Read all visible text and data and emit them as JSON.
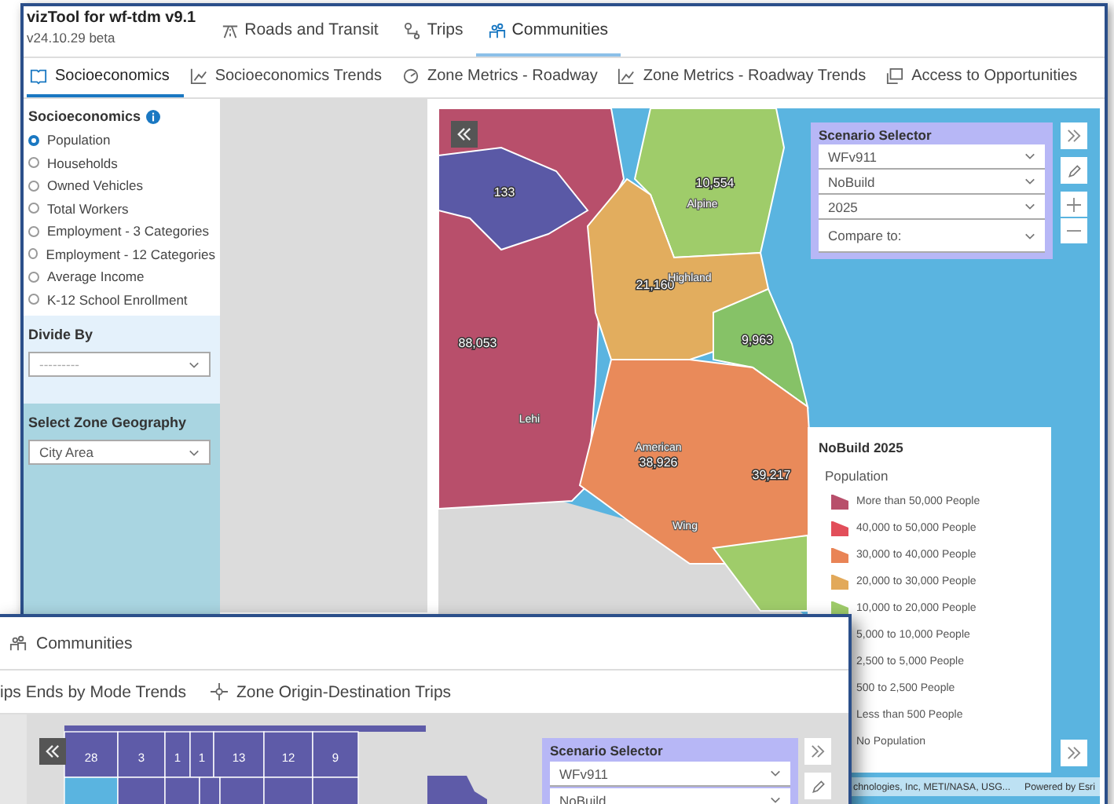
{
  "main_window": {
    "app_title": "vizTool for wf-tdm v9.1",
    "version": "v24.10.29 beta",
    "tabs": [
      {
        "label": "Roads and Transit",
        "selected": false
      },
      {
        "label": "Trips",
        "selected": false
      },
      {
        "label": "Communities",
        "selected": true
      }
    ],
    "subtabs": [
      {
        "label": "Socioeconomics",
        "selected": true
      },
      {
        "label": "Socioeconomics Trends",
        "selected": false
      },
      {
        "label": "Zone Metrics - Roadway",
        "selected": false
      },
      {
        "label": "Zone Metrics - Roadway Trends",
        "selected": false
      },
      {
        "label": "Access to Opportunities",
        "selected": false
      }
    ],
    "sidebar": {
      "heading": "Socioeconomics",
      "radios": [
        {
          "label": "Population",
          "selected": true
        },
        {
          "label": "Households",
          "selected": false
        },
        {
          "label": "Owned Vehicles",
          "selected": false
        },
        {
          "label": "Total Workers",
          "selected": false
        },
        {
          "label": "Employment - 3 Categories",
          "selected": false
        },
        {
          "label": "Employment - 12 Categories",
          "selected": false
        },
        {
          "label": "Average Income",
          "selected": false
        },
        {
          "label": "K-12 School Enrollment",
          "selected": false
        }
      ],
      "divide_by": {
        "label": "Divide By",
        "placeholder": "---------"
      },
      "zone_geography": {
        "label": "Select Zone Geography",
        "value": "City Area"
      }
    },
    "map": {
      "labels": [
        {
          "kind": "value",
          "text": "133"
        },
        {
          "kind": "value",
          "text": "10,554"
        },
        {
          "kind": "place",
          "text": "Alpine"
        },
        {
          "kind": "value",
          "text": "21,160"
        },
        {
          "kind": "place",
          "text": "Highland"
        },
        {
          "kind": "value",
          "text": "9,963"
        },
        {
          "kind": "value",
          "text": "88,053"
        },
        {
          "kind": "place",
          "text": "Lehi"
        },
        {
          "kind": "place",
          "text": "American"
        },
        {
          "kind": "value",
          "text": "38,926"
        },
        {
          "kind": "value",
          "text": "39,217"
        },
        {
          "kind": "place",
          "text": "Wing"
        }
      ],
      "scenario_selector": {
        "title": "Scenario Selector",
        "selects": [
          "WFv911",
          "NoBuild",
          "2025"
        ],
        "compare_placeholder": "Compare to:"
      },
      "legend": {
        "title": "NoBuild 2025",
        "subtitle": "Population",
        "items": [
          {
            "label": "More than 50,000 People",
            "color": "#b84f6b"
          },
          {
            "label": "40,000 to 50,000 People",
            "color": "#e24e5a"
          },
          {
            "label": "30,000 to 40,000 People",
            "color": "#e98456"
          },
          {
            "label": "20,000 to 30,000 People",
            "color": "#e2a95a"
          },
          {
            "label": "10,000 to 20,000 People",
            "color": "#9fcc6a"
          },
          {
            "label": "5,000 to 10,000 People"
          },
          {
            "label": "2,500 to 5,000 People"
          },
          {
            "label": "500 to 2,500 People"
          },
          {
            "label": "Less than 500 People"
          },
          {
            "label": "No Population"
          }
        ]
      },
      "attribution": "chnologies, Inc, METI/NASA, USG...",
      "credit": "Powered by Esri"
    }
  },
  "second_window": {
    "tab": {
      "label": "Communities"
    },
    "subtabs": [
      {
        "label": "ips Ends by Mode Trends"
      },
      {
        "label": "Zone Origin-Destination Trips"
      }
    ],
    "map": {
      "cells": [
        {
          "text": "28",
          "color": "#5e5ba8"
        },
        {
          "text": "3",
          "color": "#5e5ba8"
        },
        {
          "text": "1",
          "color": "#5e5ba8"
        },
        {
          "text": "1",
          "color": "#5e5ba8"
        },
        {
          "text": "13",
          "color": "#5e5ba8"
        },
        {
          "text": "12",
          "color": "#5e5ba8"
        },
        {
          "text": "9",
          "color": "#5e5ba8"
        },
        {
          "color": "#5ab4e0"
        },
        {
          "color": "#5e5ba8"
        },
        {
          "color": "#5e5ba8"
        },
        {
          "color": "#5e5ba8"
        },
        {
          "color": "#5e5ba8"
        },
        {
          "color": "#5e5ba8"
        },
        {
          "color": "#5e5ba8"
        }
      ],
      "scenario_selector": {
        "title": "Scenario Selector",
        "selects": [
          "WFv911",
          "NoBuild"
        ]
      }
    }
  }
}
